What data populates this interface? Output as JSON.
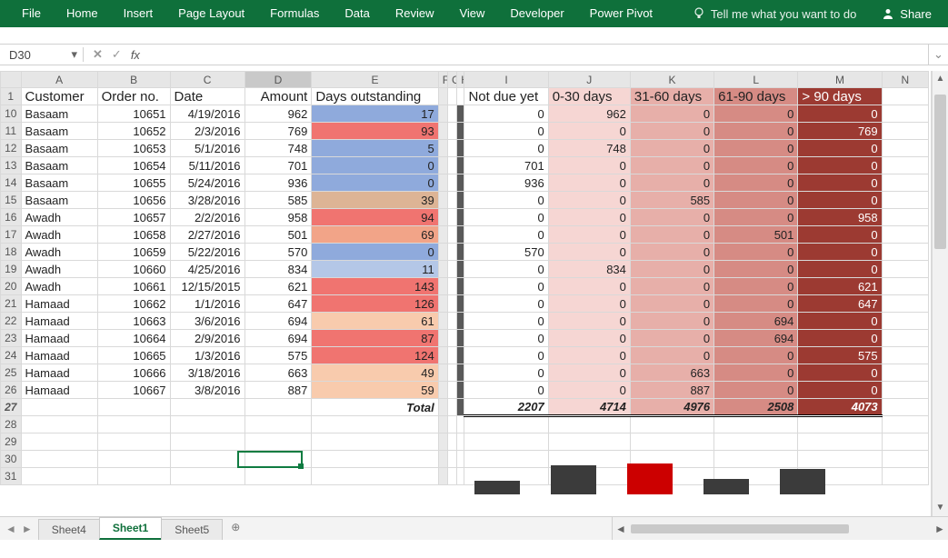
{
  "ribbon": {
    "tabs": [
      "File",
      "Home",
      "Insert",
      "Page Layout",
      "Formulas",
      "Data",
      "Review",
      "View",
      "Developer",
      "Power Pivot"
    ],
    "tell": "Tell me what you want to do",
    "share": "Share"
  },
  "formula_bar": {
    "namebox": "D30",
    "fx_label": "fx",
    "formula": ""
  },
  "columns": [
    "A",
    "B",
    "C",
    "D",
    "E",
    "F",
    "G",
    "H",
    "I",
    "J",
    "K",
    "L",
    "M",
    "N"
  ],
  "selected_column": "D",
  "active_cell": "D30",
  "headers": {
    "A": "Customer",
    "B": "Order no.",
    "C": "Date",
    "D": "Amount",
    "E": "Days outstanding",
    "I": "Not due yet",
    "J": "0-30 days",
    "K": "31-60 days",
    "L": "61-90 days",
    "M": "> 90 days"
  },
  "rows": [
    {
      "n": 10,
      "A": "Basaam",
      "B": 10651,
      "C": "4/19/2016",
      "D": 962,
      "E": 17,
      "Eclass": "e-blue",
      "I": 0,
      "J": 962,
      "K": 0,
      "L": 0,
      "M": 0
    },
    {
      "n": 11,
      "A": "Basaam",
      "B": 10652,
      "C": "2/3/2016",
      "D": 769,
      "E": 93,
      "Eclass": "e-red",
      "I": 0,
      "J": 0,
      "K": 0,
      "L": 0,
      "M": 769
    },
    {
      "n": 12,
      "A": "Basaam",
      "B": 10653,
      "C": "5/1/2016",
      "D": 748,
      "E": 5,
      "Eclass": "e-blue",
      "I": 0,
      "J": 748,
      "K": 0,
      "L": 0,
      "M": 0
    },
    {
      "n": 13,
      "A": "Basaam",
      "B": 10654,
      "C": "5/11/2016",
      "D": 701,
      "E": 0,
      "Eclass": "e-blue",
      "I": 701,
      "J": 0,
      "K": 0,
      "L": 0,
      "M": 0
    },
    {
      "n": 14,
      "A": "Basaam",
      "B": 10655,
      "C": "5/24/2016",
      "D": 936,
      "E": 0,
      "Eclass": "e-blue",
      "I": 936,
      "J": 0,
      "K": 0,
      "L": 0,
      "M": 0
    },
    {
      "n": 15,
      "A": "Basaam",
      "B": 10656,
      "C": "3/28/2016",
      "D": 585,
      "E": 39,
      "Eclass": "e-tan",
      "I": 0,
      "J": 0,
      "K": 585,
      "L": 0,
      "M": 0
    },
    {
      "n": 16,
      "A": "Awadh",
      "B": 10657,
      "C": "2/2/2016",
      "D": 958,
      "E": 94,
      "Eclass": "e-red",
      "I": 0,
      "J": 0,
      "K": 0,
      "L": 0,
      "M": 958
    },
    {
      "n": 17,
      "A": "Awadh",
      "B": 10658,
      "C": "2/27/2016",
      "D": 501,
      "E": 69,
      "Eclass": "e-rose",
      "I": 0,
      "J": 0,
      "K": 0,
      "L": 501,
      "M": 0
    },
    {
      "n": 18,
      "A": "Awadh",
      "B": 10659,
      "C": "5/22/2016",
      "D": 570,
      "E": 0,
      "Eclass": "e-blue",
      "I": 570,
      "J": 0,
      "K": 0,
      "L": 0,
      "M": 0
    },
    {
      "n": 19,
      "A": "Awadh",
      "B": 10660,
      "C": "4/25/2016",
      "D": 834,
      "E": 11,
      "Eclass": "e-blue2",
      "I": 0,
      "J": 834,
      "K": 0,
      "L": 0,
      "M": 0
    },
    {
      "n": 20,
      "A": "Awadh",
      "B": 10661,
      "C": "12/15/2015",
      "D": 621,
      "E": 143,
      "Eclass": "e-red",
      "I": 0,
      "J": 0,
      "K": 0,
      "L": 0,
      "M": 621
    },
    {
      "n": 21,
      "A": "Hamaad",
      "B": 10662,
      "C": "1/1/2016",
      "D": 647,
      "E": 126,
      "Eclass": "e-red",
      "I": 0,
      "J": 0,
      "K": 0,
      "L": 0,
      "M": 647
    },
    {
      "n": 22,
      "A": "Hamaad",
      "B": 10663,
      "C": "3/6/2016",
      "D": 694,
      "E": 61,
      "Eclass": "e-peach",
      "I": 0,
      "J": 0,
      "K": 0,
      "L": 694,
      "M": 0
    },
    {
      "n": 23,
      "A": "Hamaad",
      "B": 10664,
      "C": "2/9/2016",
      "D": 694,
      "E": 87,
      "Eclass": "e-red",
      "I": 0,
      "J": 0,
      "K": 0,
      "L": 694,
      "M": 0
    },
    {
      "n": 24,
      "A": "Hamaad",
      "B": 10665,
      "C": "1/3/2016",
      "D": 575,
      "E": 124,
      "Eclass": "e-red",
      "I": 0,
      "J": 0,
      "K": 0,
      "L": 0,
      "M": 575
    },
    {
      "n": 25,
      "A": "Hamaad",
      "B": 10666,
      "C": "3/18/2016",
      "D": 663,
      "E": 49,
      "Eclass": "e-peach",
      "I": 0,
      "J": 0,
      "K": 663,
      "L": 0,
      "M": 0
    },
    {
      "n": 26,
      "A": "Hamaad",
      "B": 10667,
      "C": "3/8/2016",
      "D": 887,
      "E": 59,
      "Eclass": "e-peach",
      "I": 0,
      "J": 0,
      "K": 887,
      "L": 0,
      "M": 0
    }
  ],
  "total": {
    "label": "Total",
    "I": 2207,
    "J": 4714,
    "K": 4976,
    "L": 2508,
    "M": 4073
  },
  "blank_rows": [
    28,
    29,
    30,
    31
  ],
  "chart_data": {
    "type": "bar",
    "categories": [
      "Not due yet",
      "0-30 days",
      "31-60 days",
      "61-90 days",
      "> 90 days"
    ],
    "values": [
      2207,
      4714,
      4976,
      2508,
      4073
    ],
    "colors": [
      "#3b3b3b",
      "#3b3b3b",
      "#cc0000",
      "#3b3b3b",
      "#3b3b3b"
    ],
    "title": "",
    "xlabel": "",
    "ylabel": "",
    "ylim": [
      0,
      5000
    ]
  },
  "sheets": {
    "tabs": [
      "Sheet4",
      "Sheet1",
      "Sheet5"
    ],
    "active": "Sheet1"
  }
}
